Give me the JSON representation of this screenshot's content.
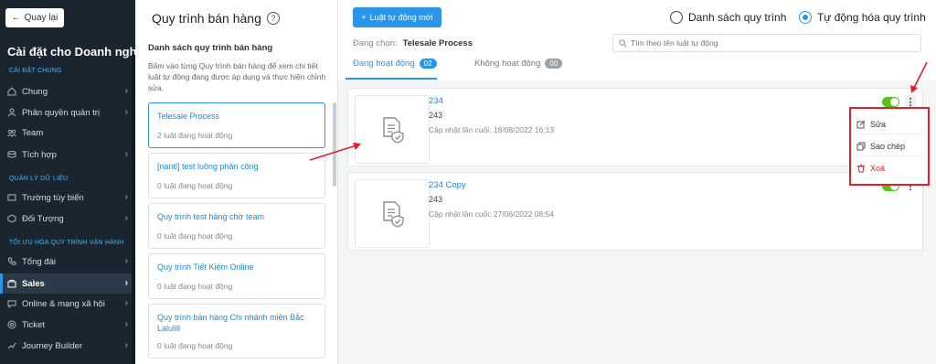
{
  "sidebar": {
    "back_label": "Quay lại",
    "title": "Cài đặt cho Doanh nghiệp",
    "sections": [
      "CÀI ĐẶT CHUNG",
      "QUẢN LÝ DỮ LIỆU",
      "TỐI ƯU HÓA QUY TRÌNH VẬN HÀNH"
    ],
    "items": [
      {
        "label": "Chung",
        "icon": "home-icon"
      },
      {
        "label": "Phân quyền quản trị",
        "icon": "permission-icon"
      },
      {
        "label": "Team",
        "icon": "team-icon"
      },
      {
        "label": "Tích hợp",
        "icon": "integration-icon"
      },
      {
        "label": "Trường tùy biến",
        "icon": "custom-field-icon"
      },
      {
        "label": "Đối Tượng",
        "icon": "object-icon"
      },
      {
        "label": "Tổng đài",
        "icon": "phone-icon"
      },
      {
        "label": "Sales",
        "icon": "sales-icon"
      },
      {
        "label": "Online & mạng xã hội",
        "icon": "chat-icon"
      },
      {
        "label": "Ticket",
        "icon": "ticket-icon"
      },
      {
        "label": "Journey Builder",
        "icon": "journey-icon"
      }
    ]
  },
  "middle": {
    "title": "Quy trình bán hàng",
    "subtitle": "Danh sách quy trình bán hàng",
    "description": "Bấm vào từng Quy trình bán hàng để xem chi tiết luật tự động đang được áp dụng và thực hiện chỉnh sửa.",
    "processes": [
      {
        "name": "Telesale Process",
        "count": "2 luật đang hoạt động"
      },
      {
        "name": "[nantl] test luồng phân công",
        "count": "0 luật đang hoạt động"
      },
      {
        "name": "Quy trình test hàng chờ team",
        "count": "0 luật đang hoạt động"
      },
      {
        "name": "Quy trình Tiết Kiệm Online",
        "count": "0 luật đang hoạt động"
      },
      {
        "name": "Quy trình bán hàng Chi nhánh miền Bắc Lalulill",
        "count": "0 luật đang hoạt động"
      }
    ]
  },
  "right": {
    "add_button": "Luật tự động mới",
    "radio_list": "Danh sách quy trình",
    "radio_auto": "Tự động hóa quy trình",
    "selecting_label": "Đang chọn:",
    "selecting_value": "Telesale Process",
    "search_placeholder": "Tìm theo tên luật tự động",
    "tab_active": "Đang hoạt động",
    "tab_active_count": "02",
    "tab_inactive": "Không hoạt động",
    "tab_inactive_count": "00",
    "rules": [
      {
        "name": "234",
        "code": "243",
        "updated": "Cập nhật lần cuối: 18/08/2022 16:13"
      },
      {
        "name": "234 Copy",
        "code": "243",
        "updated": "Cập nhật lần cuối: 27/06/2022 08:54"
      }
    ],
    "menu": {
      "edit": "Sửa",
      "copy": "Sao chép",
      "delete": "Xoá"
    }
  },
  "colors": {
    "accent": "#2b95e9",
    "sidebar_bg": "#1b2530",
    "danger": "#e21f2a",
    "toggle_on": "#52c41a"
  }
}
